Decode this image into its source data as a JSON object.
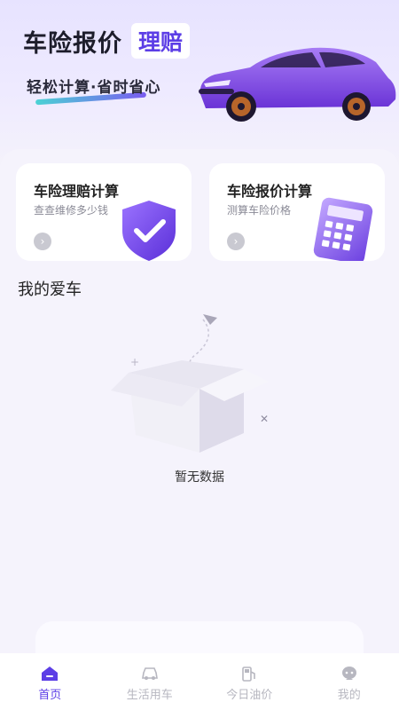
{
  "hero": {
    "title": "车险报价",
    "title_highlight": "理赔",
    "subtitle": "轻松计算·省时省心"
  },
  "cards": [
    {
      "title": "车险理赔计算",
      "subtitle": "查查维修多少钱",
      "icon": "shield-check-icon"
    },
    {
      "title": "车险报价计算",
      "subtitle": "测算车险价格",
      "icon": "calculator-icon"
    }
  ],
  "arrow_glyph": "›",
  "my_car": {
    "title": "我的爱车",
    "empty_text": "暂无数据"
  },
  "tabbar": {
    "tabs": [
      {
        "label": "首页",
        "icon": "home-icon",
        "active": true
      },
      {
        "label": "生活用车",
        "icon": "car-icon",
        "active": false
      },
      {
        "label": "今日油价",
        "icon": "fuel-icon",
        "active": false
      },
      {
        "label": "我的",
        "icon": "profile-icon",
        "active": false
      }
    ]
  },
  "colors": {
    "accent": "#5c3ee6",
    "inactive": "#b7b7c0",
    "background": "#f5f3fc"
  }
}
